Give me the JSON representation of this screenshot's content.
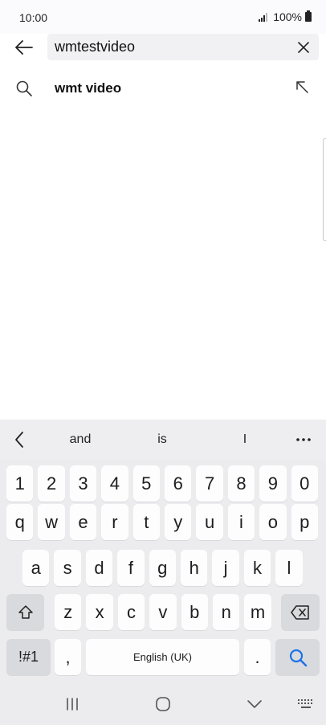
{
  "status_bar": {
    "time": "10:00",
    "battery": "100%"
  },
  "search": {
    "query": "wmtestvideo"
  },
  "suggestions": [
    {
      "text": "wmt video"
    }
  ],
  "keyboard": {
    "predictions": [
      "and",
      "is",
      "I"
    ],
    "number_row": [
      "1",
      "2",
      "3",
      "4",
      "5",
      "6",
      "7",
      "8",
      "9",
      "0"
    ],
    "row1": [
      "q",
      "w",
      "e",
      "r",
      "t",
      "y",
      "u",
      "i",
      "o",
      "p"
    ],
    "row2": [
      "a",
      "s",
      "d",
      "f",
      "g",
      "h",
      "j",
      "k",
      "l"
    ],
    "row3": [
      "z",
      "x",
      "c",
      "v",
      "b",
      "n",
      "m"
    ],
    "symbols_key": "!#1",
    "comma_key": ",",
    "space_label": "English (UK)",
    "period_key": "."
  },
  "colors": {
    "accent": "#1a73e8",
    "key_bg": "#fdfdfd",
    "function_key_bg": "#d9dadd",
    "keyboard_bg": "#ececef"
  },
  "icons": {
    "back": "arrow-left-icon",
    "clear": "close-icon",
    "suggestion": "search-icon",
    "fill": "arrow-up-left-icon",
    "shift": "shift-icon",
    "backspace": "backspace-icon",
    "search_action": "search-icon"
  }
}
